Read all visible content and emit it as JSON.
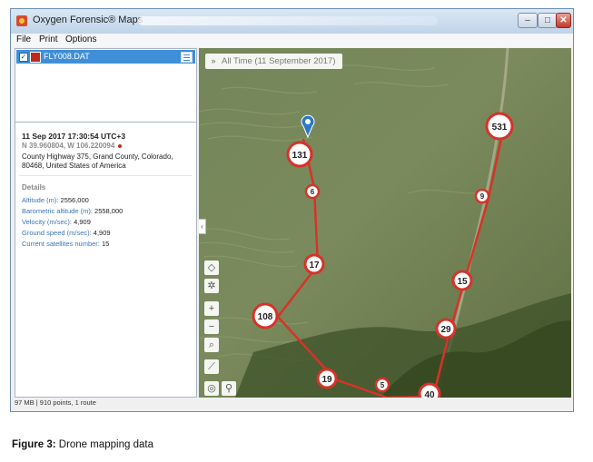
{
  "window": {
    "title": "Oxygen Forensic® Maps",
    "controls": {
      "minimize": "–",
      "maximize": "□",
      "close": "✕"
    }
  },
  "menu": [
    "File",
    "Print",
    "Options"
  ],
  "file_list": [
    {
      "name": "FLY008.DAT",
      "checked": true,
      "color": "#c0281e"
    }
  ],
  "details": {
    "datetime": "11 Sep 2017  17:30:54  UTC+3",
    "coordinates": "N 39.960804, W 106.220094",
    "address": "County Highway 375, Grand County, Colorado, 80468, United States of America",
    "section_title": "Details",
    "properties": [
      {
        "label": "Altitude (m):",
        "value": "2556,000"
      },
      {
        "label": "Barometric altitude (m):",
        "value": "2558,000"
      },
      {
        "label": "Velocity (m/sec):",
        "value": "4,909"
      },
      {
        "label": "Ground speed (m/sec):",
        "value": "4,909"
      },
      {
        "label": "Current satellites number:",
        "value": "15"
      }
    ]
  },
  "status_bar": "97 MB | 910 points, 1 route",
  "map": {
    "time_filter": "All Time (11 September 2017)",
    "route_color": "#d6332a",
    "markers": [
      "131",
      "6",
      "17",
      "108",
      "19",
      "5",
      "40",
      "29",
      "15",
      "9",
      "531"
    ],
    "tools": [
      "layers-icon",
      "settings-icon",
      "zoom-in-icon",
      "zoom-out-icon",
      "search-zoom-icon",
      "ruler-icon",
      "locate-icon",
      "pins-icon"
    ]
  },
  "caption": {
    "label": "Figure 3:",
    "text": " Drone mapping data"
  }
}
